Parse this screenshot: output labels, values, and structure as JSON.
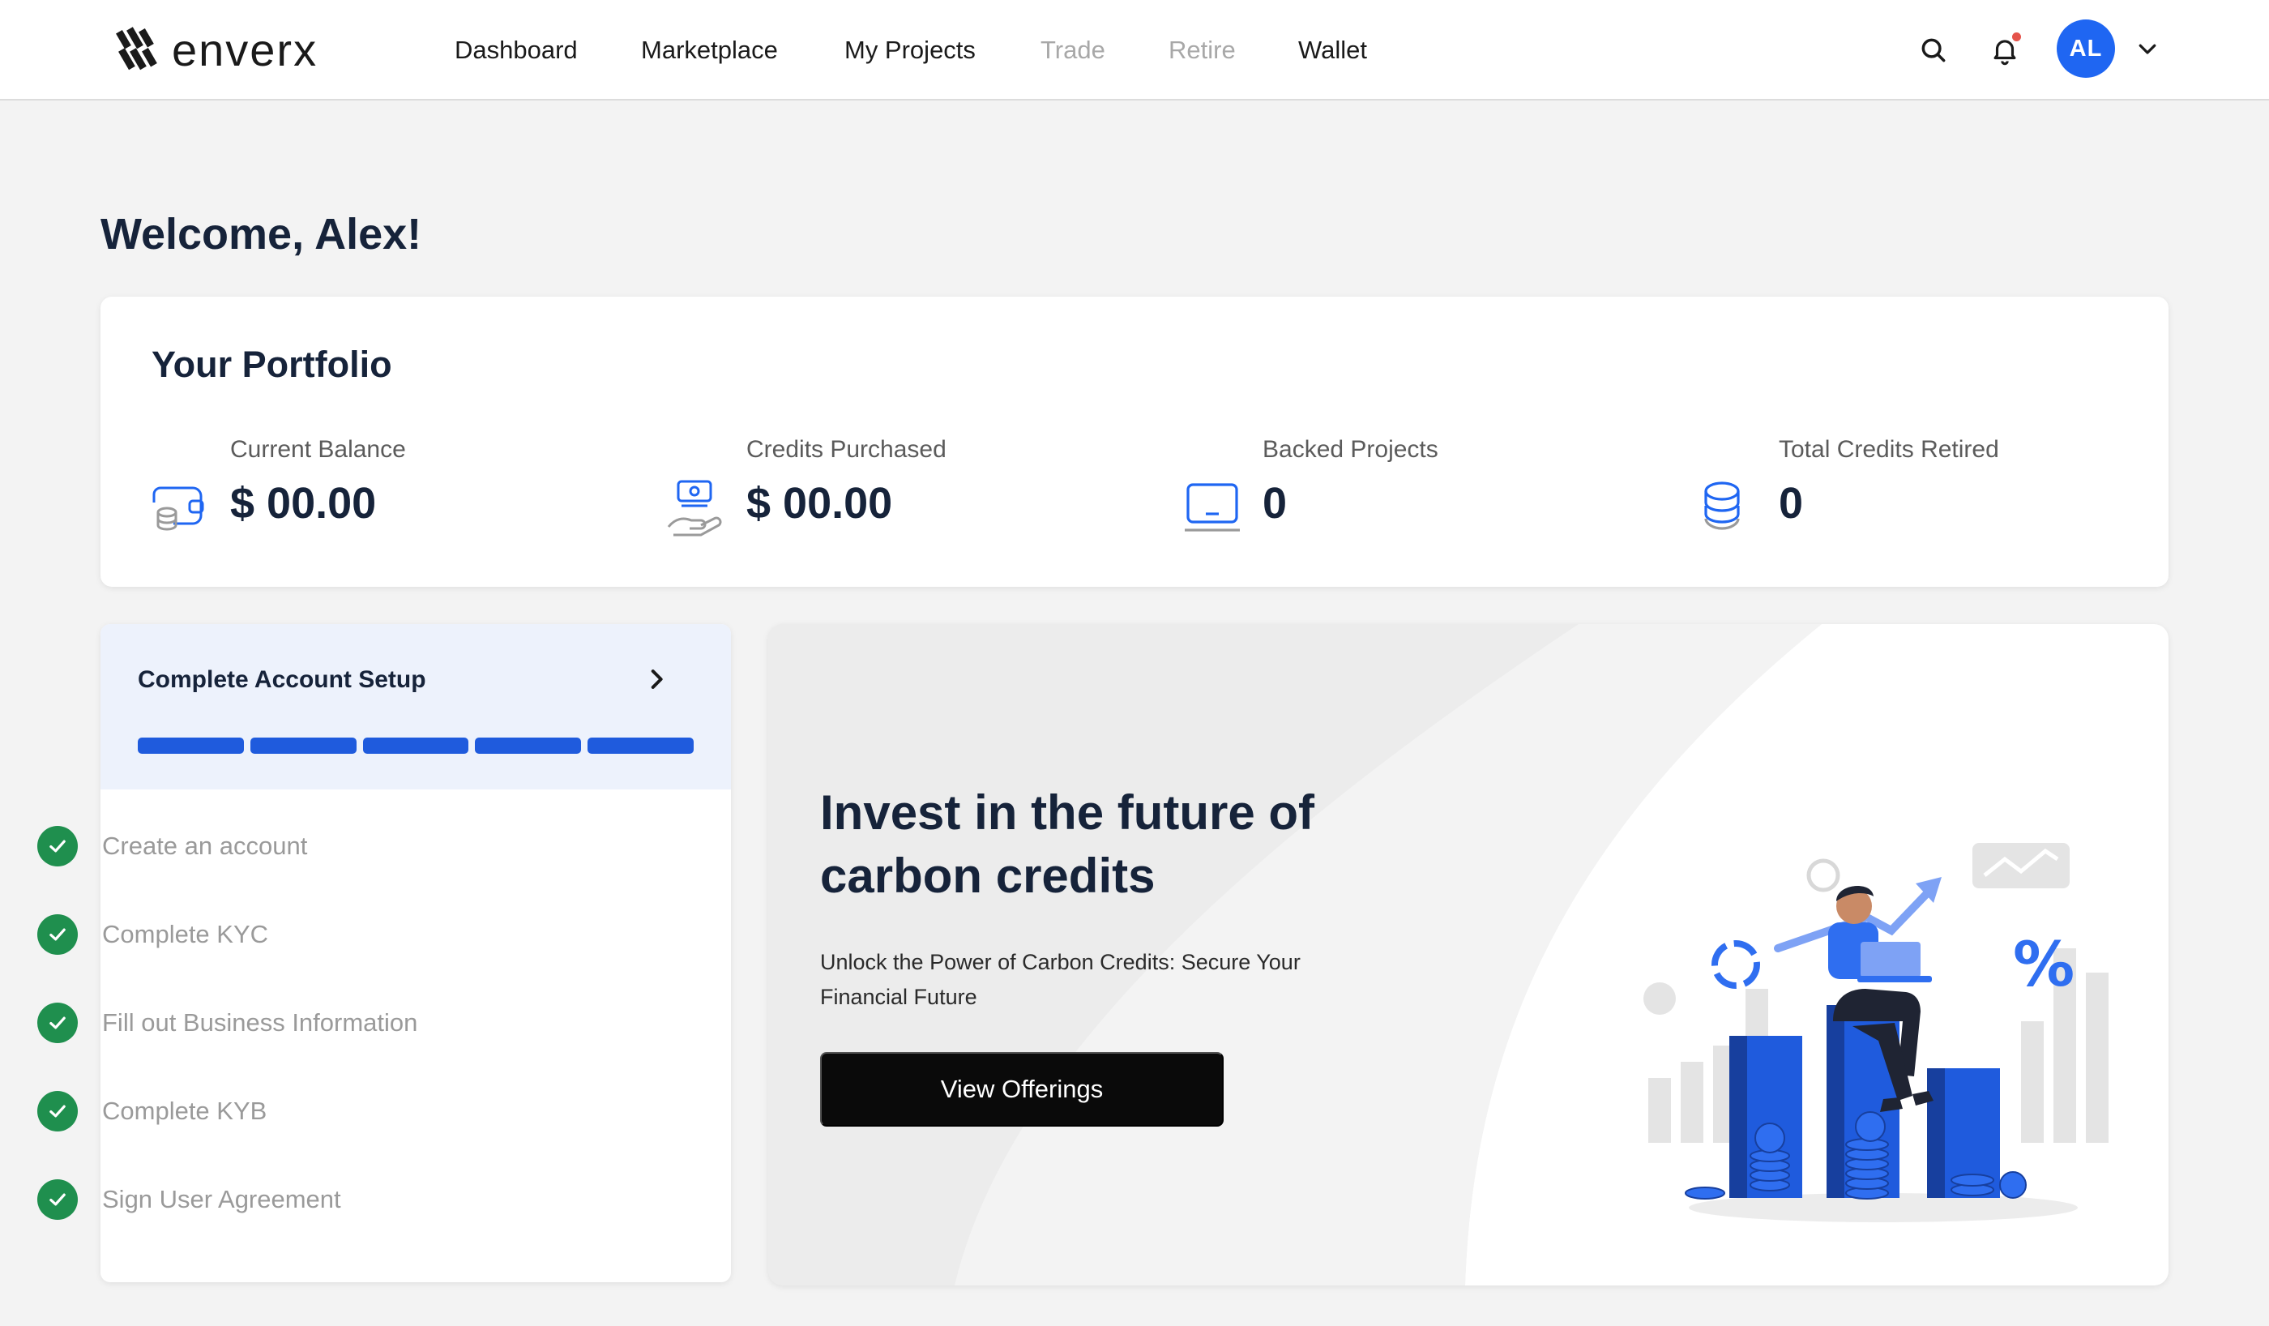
{
  "app": {
    "logo_text": "enverx"
  },
  "nav": {
    "dashboard": "Dashboard",
    "marketplace": "Marketplace",
    "my_projects": "My Projects",
    "trade": "Trade",
    "retire": "Retire",
    "wallet": "Wallet"
  },
  "user": {
    "initials": "AL"
  },
  "welcome": "Welcome, Alex!",
  "portfolio": {
    "title": "Your Portfolio",
    "stats": [
      {
        "label": "Current Balance",
        "value": "$ 00.00",
        "icon": "wallet-coins-icon"
      },
      {
        "label": "Credits Purchased",
        "value": "$ 00.00",
        "icon": "cash-hand-icon"
      },
      {
        "label": "Backed Projects",
        "value": "0",
        "icon": "laptop-icon"
      },
      {
        "label": "Total Credits Retired",
        "value": "0",
        "icon": "coin-stack-icon"
      }
    ]
  },
  "setup": {
    "title": "Complete Account Setup",
    "progress": {
      "completed_steps": 5,
      "total_steps": 5
    },
    "steps": [
      {
        "label": "Create an account",
        "done": true
      },
      {
        "label": "Complete KYC",
        "done": true
      },
      {
        "label": "Fill out Business Information",
        "done": true
      },
      {
        "label": "Complete KYB",
        "done": true
      },
      {
        "label": "Sign User Agreement",
        "done": true
      }
    ]
  },
  "promo": {
    "title": "Invest in the future of carbon credits",
    "subtitle": "Unlock the Power of Carbon Credits: Secure Your Financial Future",
    "button": "View Offerings"
  },
  "colors": {
    "accent": "#1f66f2",
    "progress": "#1f5bdd",
    "success": "#1f8f4e",
    "text": "#16233a"
  }
}
